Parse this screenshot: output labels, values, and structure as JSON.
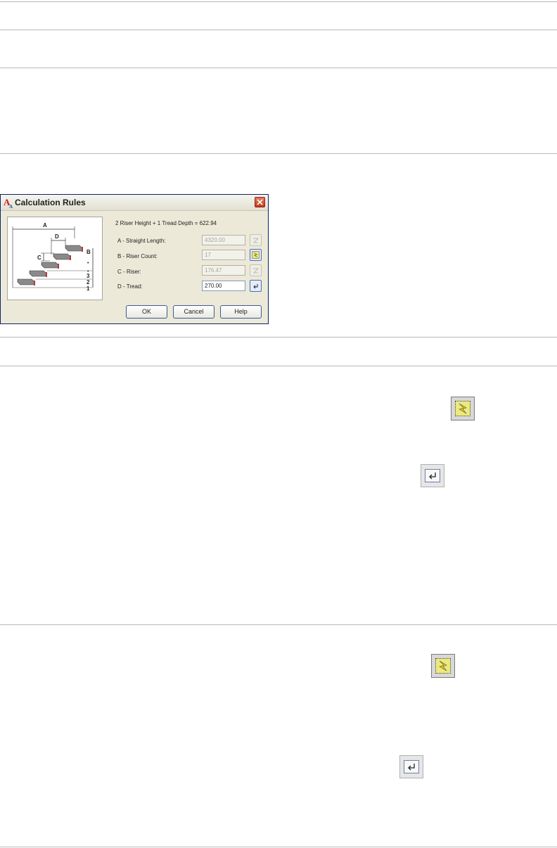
{
  "dialog": {
    "title": "Calculation Rules",
    "formula": "2 Riser Height + 1 Tread Depth = 622.94",
    "fields": [
      {
        "label": "A - Straight Length:",
        "value": "4320.00",
        "editable": false,
        "button_icon": "calculator-off-icon"
      },
      {
        "label": "B - Riser Count:",
        "value": "17",
        "editable": false,
        "button_icon": "automatic-calculation-icon"
      },
      {
        "label": "C - Riser:",
        "value": "176.47",
        "editable": false,
        "button_icon": "calculator-off-icon"
      },
      {
        "label": "D - Tread:",
        "value": "270.00",
        "editable": true,
        "button_icon": "enter-value-icon"
      }
    ],
    "diagram": {
      "labels": {
        "a": "A",
        "b": "B",
        "c": "C",
        "d": "D",
        "n1": "1",
        "n2": "2",
        "n3": "3"
      }
    },
    "buttons": {
      "ok": "OK",
      "cancel": "Cancel",
      "help": "Help"
    }
  },
  "icons": {
    "flash_1": "automatic-calculation-icon",
    "enter_1": "enter-value-icon",
    "flash_2": "automatic-calculation-icon",
    "enter_2": "enter-value-icon"
  },
  "colors": {
    "dialog_border": "#0a246a",
    "dialog_bg": "#ece9d8",
    "close_button": "#c6381c",
    "lightning_yellow": "#ece97f"
  }
}
